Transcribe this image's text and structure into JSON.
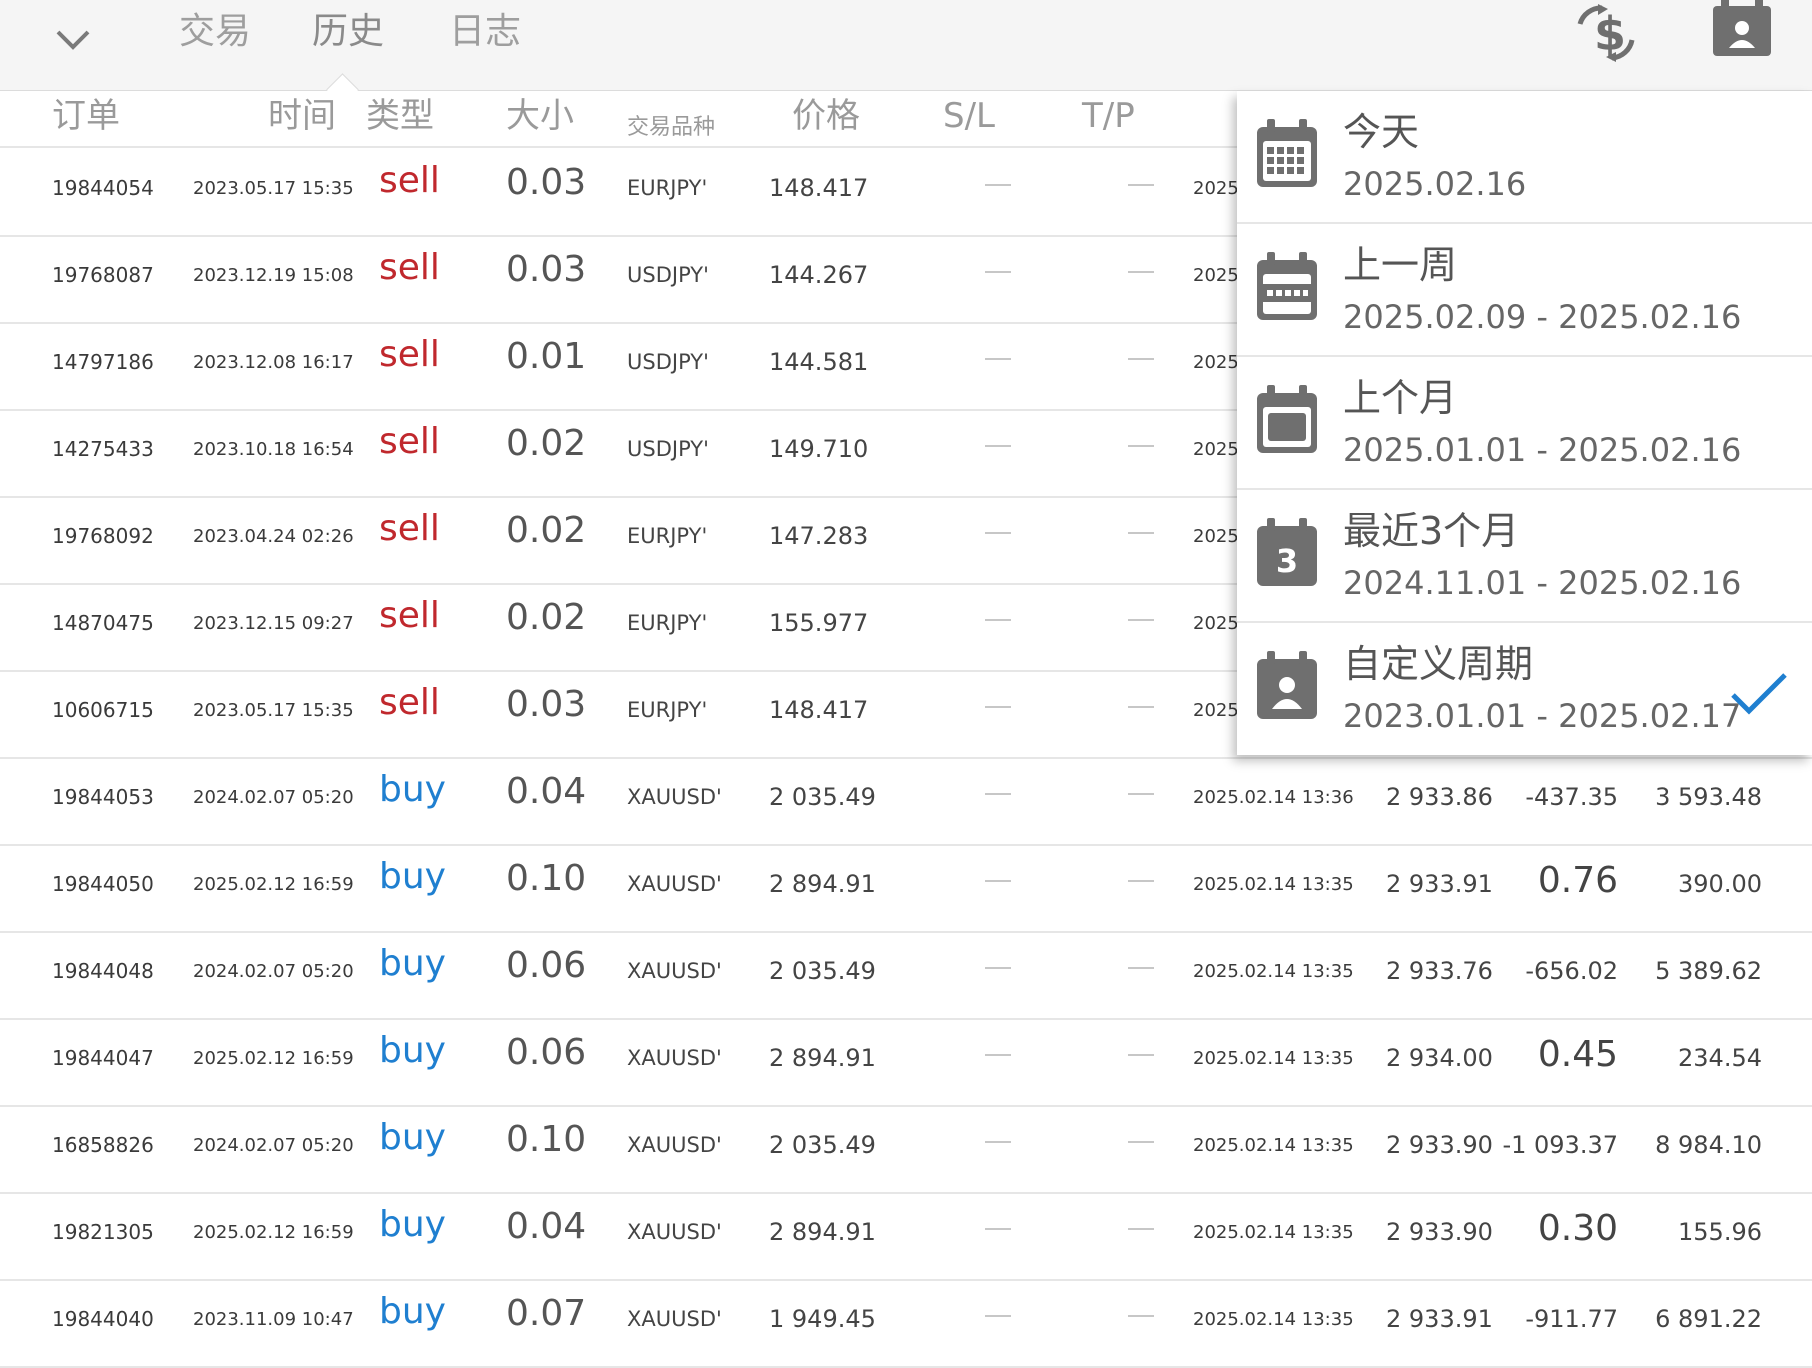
{
  "tabs": [
    {
      "label": "交易",
      "active": false
    },
    {
      "label": "历史",
      "active": true
    },
    {
      "label": "日志",
      "active": false
    }
  ],
  "icons": {
    "collapse": "chevron-down-icon",
    "currency": "dollar-exchange-icon",
    "period": "calendar-person-icon"
  },
  "table": {
    "headers": {
      "order": "订单",
      "time": "时间",
      "type": "类型",
      "size": "大小",
      "symbol": "交易品种",
      "price": "价格",
      "sl": "S/L",
      "tp": "T/P"
    },
    "rows": [
      {
        "order": "19844054",
        "time": "2023.05.17 15:35",
        "type": "sell",
        "size": "0.03",
        "symbol": "EURJPY'",
        "price": "148.417",
        "close_time": "2025",
        "close_price": "",
        "swap": "",
        "profit": ""
      },
      {
        "order": "19768087",
        "time": "2023.12.19 15:08",
        "type": "sell",
        "size": "0.03",
        "symbol": "USDJPY'",
        "price": "144.267",
        "close_time": "2025",
        "close_price": "",
        "swap": "",
        "profit": ""
      },
      {
        "order": "14797186",
        "time": "2023.12.08 16:17",
        "type": "sell",
        "size": "0.01",
        "symbol": "USDJPY'",
        "price": "144.581",
        "close_time": "2025",
        "close_price": "",
        "swap": "",
        "profit": ""
      },
      {
        "order": "14275433",
        "time": "2023.10.18 16:54",
        "type": "sell",
        "size": "0.02",
        "symbol": "USDJPY'",
        "price": "149.710",
        "close_time": "2025",
        "close_price": "",
        "swap": "",
        "profit": ""
      },
      {
        "order": "19768092",
        "time": "2023.04.24 02:26",
        "type": "sell",
        "size": "0.02",
        "symbol": "EURJPY'",
        "price": "147.283",
        "close_time": "2025",
        "close_price": "",
        "swap": "",
        "profit": ""
      },
      {
        "order": "14870475",
        "time": "2023.12.15 09:27",
        "type": "sell",
        "size": "0.02",
        "symbol": "EURJPY'",
        "price": "155.977",
        "close_time": "2025",
        "close_price": "",
        "swap": "",
        "profit": ""
      },
      {
        "order": "10606715",
        "time": "2023.05.17 15:35",
        "type": "sell",
        "size": "0.03",
        "symbol": "EURJPY'",
        "price": "148.417",
        "close_time": "2025",
        "close_price": "",
        "swap": "",
        "profit": ""
      },
      {
        "order": "19844053",
        "time": "2024.02.07 05:20",
        "type": "buy",
        "size": "0.04",
        "symbol": "XAUUSD'",
        "price": "2 035.49",
        "close_time": "2025.02.14 13:36",
        "close_price": "2 933.86",
        "swap": "-437.35",
        "profit": "3 593.48",
        "swap_big": false
      },
      {
        "order": "19844050",
        "time": "2025.02.12 16:59",
        "type": "buy",
        "size": "0.10",
        "symbol": "XAUUSD'",
        "price": "2 894.91",
        "close_time": "2025.02.14 13:35",
        "close_price": "2 933.91",
        "swap": "0.76",
        "profit": "390.00",
        "swap_big": true
      },
      {
        "order": "19844048",
        "time": "2024.02.07 05:20",
        "type": "buy",
        "size": "0.06",
        "symbol": "XAUUSD'",
        "price": "2 035.49",
        "close_time": "2025.02.14 13:35",
        "close_price": "2 933.76",
        "swap": "-656.02",
        "profit": "5 389.62",
        "swap_big": false
      },
      {
        "order": "19844047",
        "time": "2025.02.12 16:59",
        "type": "buy",
        "size": "0.06",
        "symbol": "XAUUSD'",
        "price": "2 894.91",
        "close_time": "2025.02.14 13:35",
        "close_price": "2 934.00",
        "swap": "0.45",
        "profit": "234.54",
        "swap_big": true
      },
      {
        "order": "16858826",
        "time": "2024.02.07 05:20",
        "type": "buy",
        "size": "0.10",
        "symbol": "XAUUSD'",
        "price": "2 035.49",
        "close_time": "2025.02.14 13:35",
        "close_price": "2 933.90",
        "swap": "-1 093.37",
        "profit": "8 984.10",
        "swap_big": false
      },
      {
        "order": "19821305",
        "time": "2025.02.12 16:59",
        "type": "buy",
        "size": "0.04",
        "symbol": "XAUUSD'",
        "price": "2 894.91",
        "close_time": "2025.02.14 13:35",
        "close_price": "2 933.90",
        "swap": "0.30",
        "profit": "155.96",
        "swap_big": true
      },
      {
        "order": "19844040",
        "time": "2023.11.09 10:47",
        "type": "buy",
        "size": "0.07",
        "symbol": "XAUUSD'",
        "price": "1 949.45",
        "close_time": "2025.02.14 13:35",
        "close_price": "2 933.91",
        "swap": "-911.77",
        "profit": "6 891.22",
        "swap_big": false
      }
    ]
  },
  "period_menu": {
    "options": [
      {
        "title": "今天",
        "range": "2025.02.16",
        "icon": "calendar-grid-icon",
        "selected": false
      },
      {
        "title": "上一周",
        "range": "2025.02.09 - 2025.02.16",
        "icon": "calendar-week-icon",
        "selected": false
      },
      {
        "title": "上个月",
        "range": "2025.01.01 - 2025.02.16",
        "icon": "calendar-month-icon",
        "selected": false
      },
      {
        "title": "最近3个月",
        "range": "2024.11.01 - 2025.02.16",
        "icon": "calendar-3-icon",
        "icon_text": "3",
        "selected": false
      },
      {
        "title": "自定义周期",
        "range": "2023.01.01 - 2025.02.17",
        "icon": "calendar-person-icon",
        "selected": true
      }
    ]
  },
  "colors": {
    "sell": "#c0282d",
    "buy": "#1f7fd0",
    "check": "#1f7fd0"
  }
}
